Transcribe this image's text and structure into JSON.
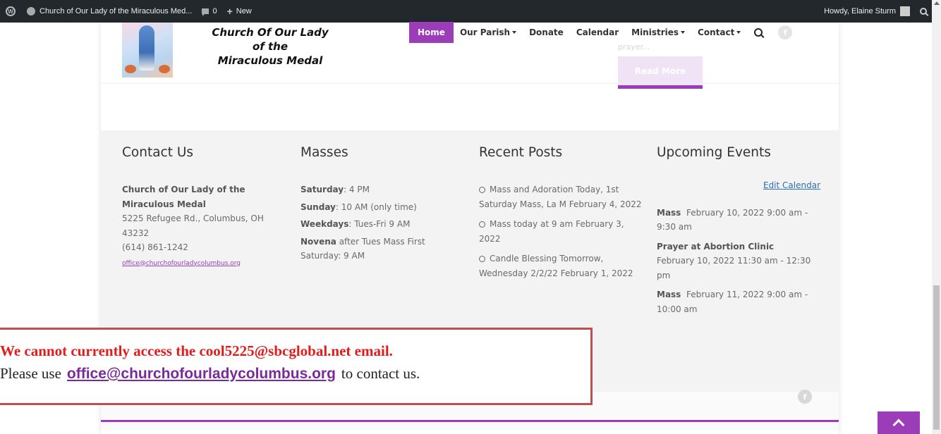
{
  "admin_bar": {
    "site_title": "Church of Our Lady of the Miraculous Med...",
    "comments_count": "0",
    "new_label": "New",
    "greeting": "Howdy, Elaine Sturm"
  },
  "header": {
    "logo_line1": "Church Of Our Lady",
    "logo_line2": "of the",
    "logo_line3": "Miraculous Medal",
    "nav": {
      "home": "Home",
      "our_parish": "Our Parish",
      "donate": "Donate",
      "calendar": "Calendar",
      "ministries": "Ministries",
      "contact": "Contact"
    },
    "ghost_text": "prayer...",
    "read_more": "Read More"
  },
  "footer": {
    "contact": {
      "title": "Contact Us",
      "name": "Church of Our Lady of the Miraculous Medal",
      "address": "5225 Refugee Rd., Columbus, OH 43232",
      "phone": "(614) 861-1242",
      "email": "office@churchofourladycolumbus.org"
    },
    "masses": {
      "title": "Masses",
      "sat_label": "Saturday",
      "sat_value": ": 4 PM",
      "sun_label": "Sunday",
      "sun_value": ": 10 AM (only time)",
      "week_label": "Weekdays",
      "week_value": ": Tues-Fri 9 AM",
      "novena_label": "Novena",
      "novena_value": " after Tues Mass First Saturday: 9 AM"
    },
    "recent_posts": {
      "title": "Recent Posts",
      "posts": [
        "Mass and Adoration Today, 1st Saturday Mass, La M February 4, 2022",
        "Mass today at 9 am February 3, 2022",
        "Candle Blessing Tomorrow, Wednesday 2/2/22 February 1, 2022"
      ]
    },
    "events": {
      "title": "Upcoming Events",
      "edit_calendar": "Edit Calendar",
      "items": [
        {
          "name": "Mass",
          "when": "February 10, 2022  9:00 am - 9:30 am"
        },
        {
          "name": "Prayer at Abortion Clinic",
          "when": "February 10, 2022  11:30 am - 12:30 pm"
        },
        {
          "name": "Mass",
          "when": "February 11, 2022  9:00 am - 10:00 am"
        }
      ]
    }
  },
  "notice": {
    "line1": "We cannot currently access the cool5225@sbcglobal.net email.",
    "line2_prefix": "Please use",
    "email": "office@churchofourladycolumbus.org",
    "line2_suffix": "to contact us."
  },
  "colors": {
    "accent": "#9b3db8",
    "notice_border": "#c0504d",
    "notice_red": "#e31b1b"
  }
}
